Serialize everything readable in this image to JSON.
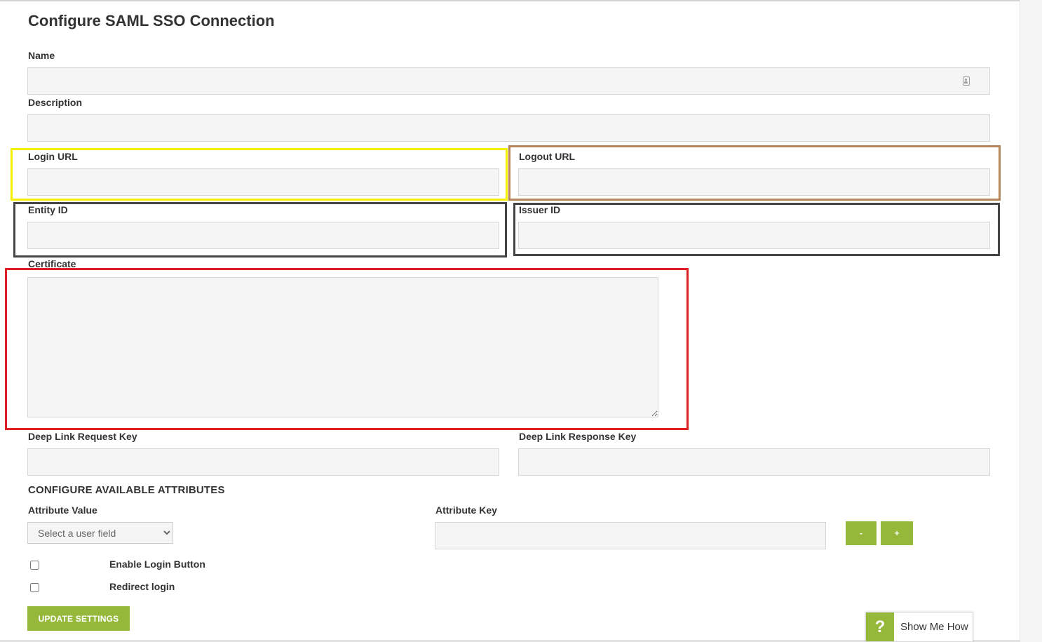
{
  "page": {
    "title": "Configure SAML SSO Connection"
  },
  "fields": {
    "name": {
      "label": "Name",
      "value": ""
    },
    "description": {
      "label": "Description",
      "value": ""
    },
    "login_url": {
      "label": "Login URL",
      "value": ""
    },
    "logout_url": {
      "label": "Logout URL",
      "value": ""
    },
    "entity_id": {
      "label": "Entity ID",
      "value": ""
    },
    "issuer_id": {
      "label": "Issuer ID",
      "value": ""
    },
    "certificate": {
      "label": "Certificate",
      "value": ""
    },
    "deep_link_request_key": {
      "label": "Deep Link Request Key",
      "value": ""
    },
    "deep_link_response_key": {
      "label": "Deep Link Response Key",
      "value": ""
    }
  },
  "attributes": {
    "heading": "CONFIGURE AVAILABLE ATTRIBUTES",
    "value_label": "Attribute Value",
    "select_placeholder": "Select a user field",
    "key_label": "Attribute Key",
    "key_value": "",
    "remove_label": "-",
    "add_label": "+"
  },
  "options": {
    "enable_login_button": {
      "label": "Enable Login Button",
      "checked": false
    },
    "redirect_login": {
      "label": "Redirect login",
      "checked": false
    }
  },
  "actions": {
    "update_label": "UPDATE SETTINGS"
  },
  "help": {
    "icon": "?",
    "label": "Show Me How"
  },
  "highlight_colors": {
    "login": "#f5f000",
    "logout": "#b8845a",
    "ids": "#444444",
    "certificate": "#e02020"
  },
  "icons": {
    "name_field": "contact-card-icon",
    "help": "question-mark-icon"
  }
}
